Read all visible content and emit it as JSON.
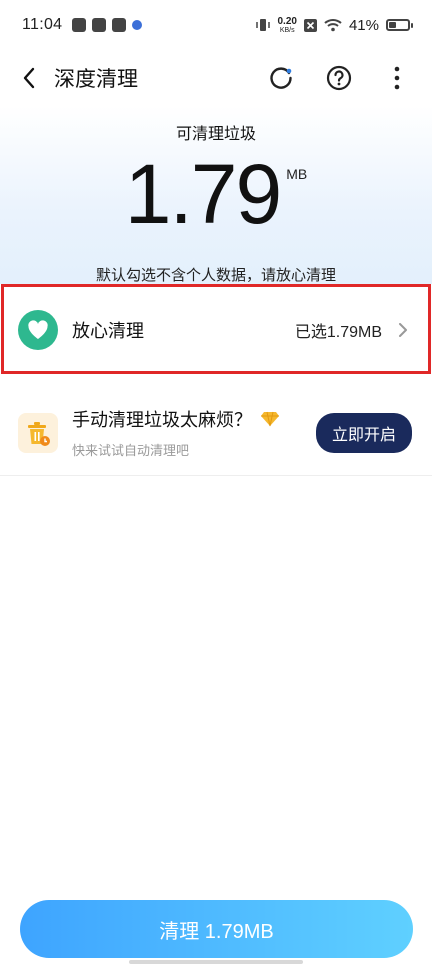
{
  "status": {
    "time": "11:04",
    "net_speed": "0.20",
    "net_unit": "KB/s",
    "battery": "41%",
    "battery_level": 0.41
  },
  "header": {
    "title": "深度清理",
    "icons": [
      "back-icon",
      "refresh-icon",
      "help-icon",
      "more-icon"
    ]
  },
  "summary": {
    "label": "可清理垃圾",
    "size": "1.79",
    "unit": "MB",
    "tip": "默认勾选不含个人数据，请放心清理"
  },
  "safe_clean": {
    "name": "放心清理",
    "selected": "已选1.79MB"
  },
  "auto_clean": {
    "title": "手动清理垃圾太麻烦？",
    "subtitle": "快来试试自动清理吧",
    "button": "立即开启"
  },
  "main_button": "清理 1.79MB",
  "colors": {
    "accent_green": "#2eb88f",
    "button_blue": "#3ea4ff",
    "dark_navy": "#1a2a5c",
    "highlight_red": "#e02828"
  }
}
